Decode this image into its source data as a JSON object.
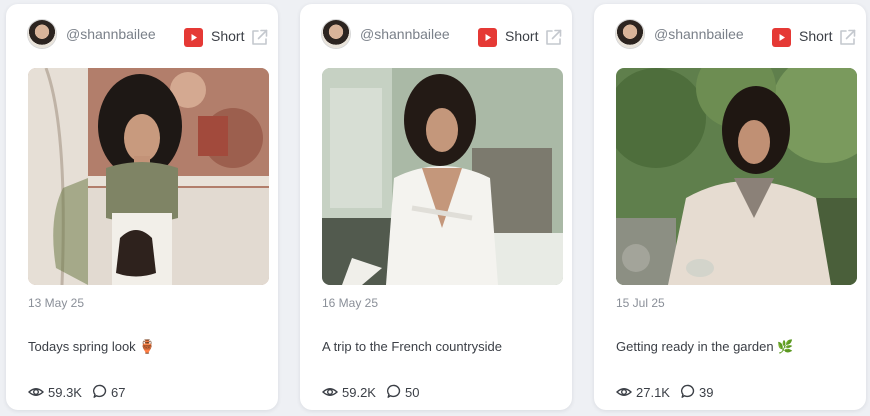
{
  "posts": [
    {
      "handle": "@shannbailee",
      "platform_label": "Short",
      "date": "13 May 25",
      "caption": "Todays spring look 🏺",
      "views": "59.3K",
      "comments": "67"
    },
    {
      "handle": "@shannbailee",
      "platform_label": "Short",
      "date": "16 May 25",
      "caption": "A trip to the French countryside",
      "views": "59.2K",
      "comments": "50"
    },
    {
      "handle": "@shannbailee",
      "platform_label": "Short",
      "date": "15 Jul 25",
      "caption": "Getting ready in the garden 🌿",
      "views": "27.1K",
      "comments": "39"
    }
  ],
  "icons": {
    "platform": "youtube-icon",
    "open": "external-link-icon",
    "views": "eye-icon",
    "comments": "comment-icon"
  },
  "colors": {
    "youtube_red": "#e53935",
    "muted_text": "#8a8f98",
    "body_text": "#3b3f46",
    "page_bg": "#eef0f4"
  }
}
